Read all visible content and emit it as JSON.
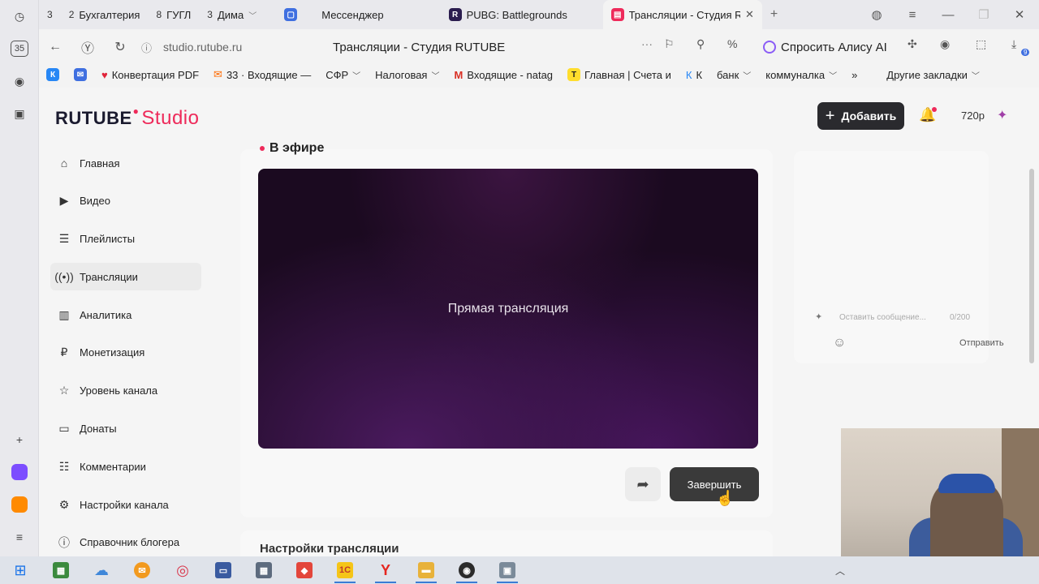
{
  "browser": {
    "tabs": [
      {
        "num": "3",
        "label": ""
      },
      {
        "num": "2",
        "label": "Бухгалтерия"
      },
      {
        "num": "8",
        "label": "ГУГЛ"
      },
      {
        "num": "3",
        "label": "Дима"
      },
      {
        "num": "",
        "label": "Мессенджер"
      },
      {
        "num": "",
        "label": "PUBG: Battlegrounds"
      },
      {
        "num": "",
        "label": "Трансляции - Студия R"
      }
    ],
    "url": "studio.rutube.ru",
    "page_title": "Трансляции - Студия RUTUBE",
    "alice_label": "Спросить Алису AI",
    "side_badge": "35",
    "ext_badge": "9",
    "bookmarks": [
      {
        "label": "Конвертация PDF",
        "chevron": false
      },
      {
        "label": "33 · Входящие — ",
        "chevron": false
      },
      {
        "label": "СФР",
        "chevron": true
      },
      {
        "label": "Налоговая",
        "chevron": true
      },
      {
        "label": "Входящие - natag",
        "chevron": false
      },
      {
        "label": "Главная | Счета и",
        "chevron": false
      },
      {
        "label": "К",
        "chevron": false
      },
      {
        "label": "банк",
        "chevron": true
      },
      {
        "label": "коммуналка",
        "chevron": true
      }
    ],
    "other_bookmarks": "Другие закладки"
  },
  "studio": {
    "logo_main": "RUTUBE",
    "logo_sub": "Studio",
    "add_label": "Добавить",
    "quality": "720p",
    "nav": [
      {
        "label": "Главная",
        "icon": "home-icon"
      },
      {
        "label": "Видео",
        "icon": "video-icon"
      },
      {
        "label": "Плейлисты",
        "icon": "playlist-icon"
      },
      {
        "label": "Трансляции",
        "icon": "broadcast-icon",
        "active": true
      },
      {
        "label": "Аналитика",
        "icon": "analytics-icon"
      },
      {
        "label": "Монетизация",
        "icon": "ruble-icon"
      },
      {
        "label": "Уровень канала",
        "icon": "star-icon"
      },
      {
        "label": "Донаты",
        "icon": "wallet-icon"
      },
      {
        "label": "Комментарии",
        "icon": "comment-icon"
      },
      {
        "label": "Настройки канала",
        "icon": "gear-icon"
      },
      {
        "label": "Справочник блогера",
        "icon": "info-icon"
      }
    ],
    "on_air_label": "В эфире",
    "player_label": "Прямая трансляция",
    "finish_label": "Завершить",
    "settings_peek": "Настройки трансляции",
    "chat": {
      "placeholder": "Оставить сообщение...",
      "counter": "0/200",
      "send_label": "Отправить"
    }
  },
  "colors": {
    "accent": "#ee2a5a",
    "dark_button": "#2a2a2e",
    "player_bg": "#1b0a20"
  }
}
